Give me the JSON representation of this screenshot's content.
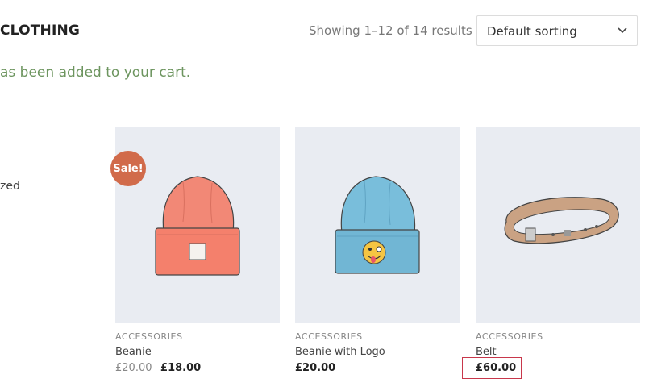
{
  "header": {
    "title": "CLOTHING",
    "result_count": "Showing 1–12 of 14 results",
    "sort": {
      "selected": "Default sorting"
    }
  },
  "notice": {
    "text": "as been added to your cart."
  },
  "sidebar": {
    "fragment": "zed"
  },
  "products": [
    {
      "category": "ACCESSORIES",
      "name": "Beanie",
      "old_price": "£20.00",
      "price": "£18.00",
      "badge": "Sale!",
      "icon": "beanie-red-icon"
    },
    {
      "category": "ACCESSORIES",
      "name": "Beanie with Logo",
      "price": "£20.00",
      "icon": "beanie-blue-logo-icon"
    },
    {
      "category": "ACCESSORIES",
      "name": "Belt",
      "price": "£60.00",
      "icon": "belt-icon"
    }
  ],
  "colors": {
    "notice_green": "#6d955f",
    "sale_badge": "#d16b4b",
    "image_bg": "#e9ecf2",
    "highlight_box": "#c8374b"
  }
}
